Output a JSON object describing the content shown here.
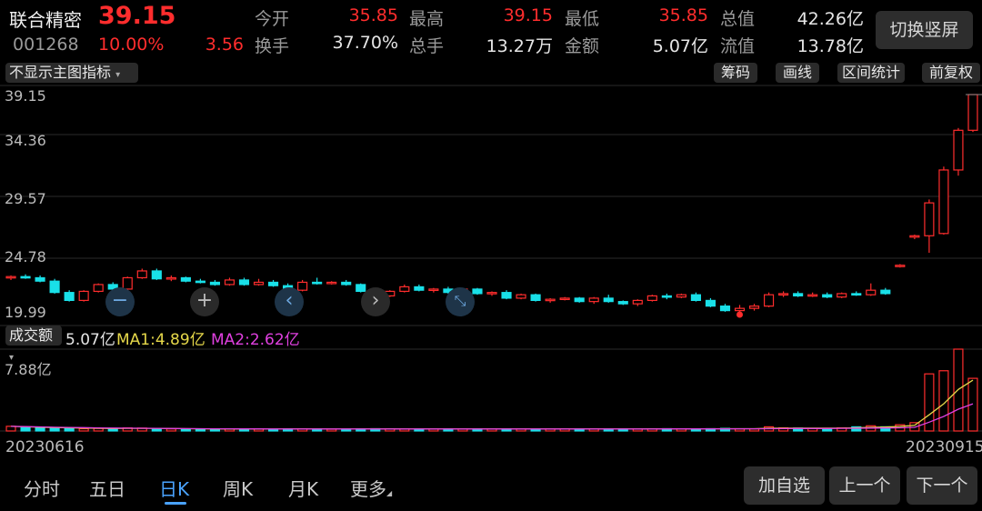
{
  "stock": {
    "name": "联合精密",
    "price": "39.15",
    "code": "001268",
    "change_pct": "10.00%",
    "change": "3.56"
  },
  "stats": [
    {
      "label": "今开",
      "value": "35.85",
      "color": "#ff2d2d"
    },
    {
      "label": "最高",
      "value": "39.15",
      "color": "#ff2d2d"
    },
    {
      "label": "最低",
      "value": "35.85",
      "color": "#ff2d2d"
    },
    {
      "label": "总值",
      "value": "42.26亿",
      "color": "#e6e6e6"
    },
    {
      "label": "换手",
      "value": "37.70%",
      "color": "#e6e6e6"
    },
    {
      "label": "总手",
      "value": "13.27万",
      "color": "#e6e6e6"
    },
    {
      "label": "金额",
      "value": "5.07亿",
      "color": "#e6e6e6"
    },
    {
      "label": "流值",
      "value": "13.78亿",
      "color": "#e6e6e6"
    }
  ],
  "switch_button": "切换竖屏",
  "indicator_select": "不显示主图指标",
  "tool_buttons": [
    "筹码",
    "画线",
    "区间统计",
    "前复权"
  ],
  "volume": {
    "select": "成交额",
    "value": "5.07亿",
    "ma1": "MA1:4.89亿",
    "ma2": "MA2:2.62亿",
    "max_label": "7.88亿"
  },
  "dates": {
    "start": "20230616",
    "end": "20230915"
  },
  "tabs": [
    "分时",
    "五日",
    "日K",
    "周K",
    "月K",
    "更多"
  ],
  "active_tab": "日K",
  "bottom_buttons": [
    "加自选",
    "上一个",
    "下一个"
  ],
  "colors": {
    "up": "#ff2d2d",
    "down": "#19e0e8",
    "ma1": "#e6d84a",
    "ma2": "#e040e0",
    "accent": "#4aa3ff"
  },
  "chart_data": {
    "type": "candlestick",
    "y_ticks": [
      "39.15",
      "34.36",
      "29.57",
      "24.78",
      "19.99"
    ],
    "ylim": [
      19.99,
      39.15
    ],
    "candles": [
      [
        23.0,
        23.2,
        22.8,
        23.1
      ],
      [
        23.1,
        23.3,
        22.9,
        23.0
      ],
      [
        23.0,
        23.2,
        22.6,
        22.7
      ],
      [
        22.7,
        22.9,
        21.6,
        21.7
      ],
      [
        21.7,
        21.9,
        20.9,
        21.0
      ],
      [
        21.0,
        21.9,
        20.9,
        21.8
      ],
      [
        21.8,
        22.5,
        21.7,
        22.4
      ],
      [
        22.4,
        22.6,
        21.9,
        22.0
      ],
      [
        22.0,
        23.1,
        21.9,
        23.0
      ],
      [
        23.0,
        23.8,
        22.9,
        23.6
      ],
      [
        23.6,
        23.8,
        22.8,
        22.9
      ],
      [
        22.9,
        23.2,
        22.7,
        23.0
      ],
      [
        23.0,
        23.1,
        22.6,
        22.7
      ],
      [
        22.7,
        22.9,
        22.5,
        22.6
      ],
      [
        22.6,
        22.8,
        22.3,
        22.4
      ],
      [
        22.4,
        23.0,
        22.3,
        22.8
      ],
      [
        22.8,
        23.0,
        22.3,
        22.4
      ],
      [
        22.4,
        22.9,
        22.3,
        22.6
      ],
      [
        22.6,
        22.8,
        22.2,
        22.3
      ],
      [
        22.3,
        22.5,
        21.8,
        21.9
      ],
      [
        21.9,
        22.8,
        21.8,
        22.6
      ],
      [
        22.6,
        23.0,
        22.4,
        22.5
      ],
      [
        22.5,
        22.7,
        22.4,
        22.6
      ],
      [
        22.6,
        22.8,
        22.3,
        22.4
      ],
      [
        22.4,
        22.5,
        21.7,
        21.8
      ],
      [
        21.8,
        22.1,
        21.2,
        21.4
      ],
      [
        21.4,
        21.9,
        21.3,
        21.8
      ],
      [
        21.8,
        22.4,
        21.7,
        22.2
      ],
      [
        22.2,
        22.4,
        21.8,
        21.9
      ],
      [
        21.9,
        22.1,
        21.7,
        22.0
      ],
      [
        22.0,
        22.2,
        21.6,
        21.7
      ],
      [
        21.7,
        22.1,
        21.5,
        22.0
      ],
      [
        22.0,
        22.1,
        21.5,
        21.6
      ],
      [
        21.6,
        21.8,
        21.4,
        21.7
      ],
      [
        21.7,
        21.9,
        21.1,
        21.2
      ],
      [
        21.2,
        21.6,
        21.1,
        21.5
      ],
      [
        21.5,
        21.6,
        20.9,
        21.0
      ],
      [
        21.0,
        21.2,
        20.8,
        21.1
      ],
      [
        21.1,
        21.3,
        21.0,
        21.2
      ],
      [
        21.2,
        21.3,
        20.8,
        20.9
      ],
      [
        20.9,
        21.3,
        20.7,
        21.2
      ],
      [
        21.2,
        21.5,
        20.8,
        20.9
      ],
      [
        20.9,
        21.0,
        20.6,
        20.7
      ],
      [
        20.7,
        21.1,
        20.5,
        21.0
      ],
      [
        21.0,
        21.5,
        20.9,
        21.4
      ],
      [
        21.4,
        21.6,
        21.1,
        21.3
      ],
      [
        21.3,
        21.6,
        21.2,
        21.5
      ],
      [
        21.5,
        21.7,
        20.9,
        21.0
      ],
      [
        21.0,
        21.2,
        20.4,
        20.5
      ],
      [
        20.5,
        20.7,
        20.0,
        20.1
      ],
      [
        20.1,
        20.6,
        19.99,
        20.3
      ],
      [
        20.3,
        20.7,
        20.1,
        20.5
      ],
      [
        20.5,
        21.7,
        20.4,
        21.5
      ],
      [
        21.5,
        21.8,
        21.3,
        21.6
      ],
      [
        21.6,
        21.8,
        21.3,
        21.4
      ],
      [
        21.4,
        21.7,
        21.3,
        21.5
      ],
      [
        21.5,
        21.7,
        21.2,
        21.3
      ],
      [
        21.3,
        21.7,
        21.2,
        21.6
      ],
      [
        21.6,
        21.8,
        21.4,
        21.5
      ],
      [
        21.5,
        22.5,
        21.4,
        21.9
      ],
      [
        21.9,
        22.1,
        21.5,
        21.6
      ],
      [
        24.0,
        24.2,
        23.9,
        24.1
      ],
      [
        26.6,
        26.8,
        26.4,
        26.7
      ],
      [
        26.7,
        29.9,
        25.2,
        29.6
      ],
      [
        26.9,
        32.8,
        26.8,
        32.5
      ],
      [
        32.5,
        36.2,
        32.0,
        36.0
      ],
      [
        36.0,
        39.15,
        35.85,
        39.15
      ]
    ],
    "volume_ylim": [
      0,
      7.88
    ],
    "volume_values": [
      0.45,
      0.35,
      0.3,
      0.25,
      0.28,
      0.22,
      0.25,
      0.2,
      0.3,
      0.28,
      0.22,
      0.2,
      0.18,
      0.2,
      0.18,
      0.2,
      0.18,
      0.18,
      0.17,
      0.2,
      0.2,
      0.18,
      0.17,
      0.18,
      0.2,
      0.22,
      0.2,
      0.18,
      0.17,
      0.18,
      0.2,
      0.18,
      0.2,
      0.18,
      0.2,
      0.18,
      0.17,
      0.18,
      0.2,
      0.18,
      0.2,
      0.18,
      0.2,
      0.18,
      0.2,
      0.22,
      0.2,
      0.2,
      0.22,
      0.25,
      0.2,
      0.2,
      0.4,
      0.3,
      0.28,
      0.25,
      0.22,
      0.3,
      0.4,
      0.5,
      0.4,
      0.6,
      0.8,
      5.5,
      5.8,
      7.88,
      5.07
    ],
    "ma1": [
      0.45,
      0.4,
      0.37,
      0.33,
      0.31,
      0.28,
      0.26,
      0.24,
      0.25,
      0.25,
      0.25,
      0.24,
      0.22,
      0.21,
      0.2,
      0.19,
      0.19,
      0.18,
      0.18,
      0.19,
      0.19,
      0.19,
      0.18,
      0.18,
      0.19,
      0.19,
      0.2,
      0.19,
      0.19,
      0.19,
      0.19,
      0.19,
      0.19,
      0.19,
      0.19,
      0.19,
      0.19,
      0.19,
      0.19,
      0.19,
      0.19,
      0.19,
      0.19,
      0.19,
      0.2,
      0.2,
      0.2,
      0.2,
      0.21,
      0.22,
      0.22,
      0.22,
      0.26,
      0.27,
      0.27,
      0.27,
      0.27,
      0.27,
      0.31,
      0.35,
      0.38,
      0.44,
      0.54,
      1.56,
      2.62,
      4.0,
      4.89
    ],
    "ma2": [
      0.45,
      0.42,
      0.39,
      0.36,
      0.34,
      0.32,
      0.3,
      0.28,
      0.27,
      0.26,
      0.25,
      0.24,
      0.23,
      0.22,
      0.21,
      0.21,
      0.2,
      0.2,
      0.19,
      0.19,
      0.19,
      0.19,
      0.19,
      0.19,
      0.19,
      0.19,
      0.19,
      0.19,
      0.19,
      0.19,
      0.19,
      0.19,
      0.19,
      0.19,
      0.19,
      0.19,
      0.19,
      0.19,
      0.19,
      0.19,
      0.19,
      0.19,
      0.19,
      0.19,
      0.19,
      0.2,
      0.2,
      0.2,
      0.2,
      0.2,
      0.21,
      0.21,
      0.22,
      0.23,
      0.24,
      0.24,
      0.24,
      0.25,
      0.26,
      0.28,
      0.29,
      0.31,
      0.35,
      0.85,
      1.4,
      2.1,
      2.62
    ]
  }
}
